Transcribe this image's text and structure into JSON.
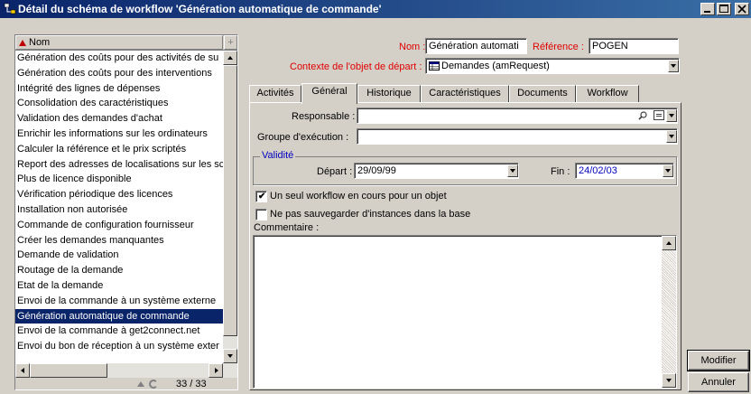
{
  "window": {
    "title": "Détail du schéma de workflow 'Génération automatique de commande'",
    "minimize_glyph": "_",
    "maximize_glyph": "□",
    "close_glyph": "×"
  },
  "list": {
    "column_header": "Nom",
    "header_add_glyph": "+",
    "rows": [
      "Génération des coûts pour des activités de su",
      "Génération des coûts pour des interventions",
      "Intégrité des lignes de dépenses",
      "Consolidation des caractéristiques",
      "Validation des demandes d'achat",
      "Enrichir les informations sur les ordinateurs",
      "Calculer la référence et le prix scriptés",
      "Report des adresses de localisations sur les sc",
      "Plus de licence disponible",
      "Vérification périodique des licences",
      "Installation non autorisée",
      "Commande de configuration fournisseur",
      "Créer les demandes manquantes",
      "Demande de validation",
      "Routage de la demande",
      "Etat de la demande",
      "Envoi de la commande à un système externe",
      "Génération automatique de commande",
      "Envoi  de la commande à get2connect.net",
      "Envoi du bon de réception à un système exter"
    ],
    "selected_index": 17,
    "count": "33 / 33"
  },
  "detail": {
    "nom_label": "Nom",
    "nom_value": "Génération automati",
    "reference_label": "Référence",
    "reference_value": "POGEN",
    "context_label": "Contexte de l'objet de départ",
    "context_value": "Demandes (amRequest)",
    "tabs": [
      "Activités",
      "Général",
      "Historique",
      "Caractéristiques",
      "Documents",
      "Workflow"
    ],
    "active_tab": 1,
    "responsable_label": "Responsable",
    "responsable_value": "",
    "groupe_label": "Groupe d'exécution",
    "groupe_value": "",
    "validity_legend": "Validité",
    "depart_label": "Départ",
    "depart_value": "29/09/99",
    "fin_label": "Fin",
    "fin_value": "24/02/03",
    "checkbox1_label": "Un seul workflow en cours pour un objet",
    "checkbox1_checked": true,
    "checkbox2_label": "Ne pas sauvegarder d'instances dans la base",
    "checkbox2_checked": false,
    "comment_label": "Commentaire :",
    "comment_value": ""
  },
  "buttons": {
    "modify": "Modifier",
    "cancel": "Annuler"
  },
  "colors": {
    "titlebar": "#0a246a",
    "selection": "#0a246a",
    "required_label": "#e00000",
    "link_value": "#0000c0",
    "face": "#d4d0c8"
  }
}
